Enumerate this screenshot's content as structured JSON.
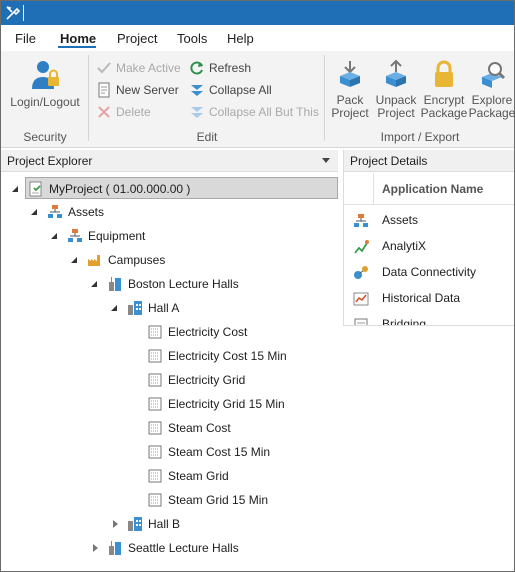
{
  "window": {
    "title": ""
  },
  "menu": {
    "items": [
      {
        "label": "File"
      },
      {
        "label": "Home"
      },
      {
        "label": "Project"
      },
      {
        "label": "Tools"
      },
      {
        "label": "Help"
      }
    ],
    "active": "Home"
  },
  "ribbon": {
    "security": {
      "group_label": "Security",
      "login_label": "Login/Logout"
    },
    "edit": {
      "group_label": "Edit",
      "make_active": "Make Active",
      "new_server": "New Server",
      "delete": "Delete",
      "refresh": "Refresh",
      "collapse_all": "Collapse All",
      "collapse_all_but_this": "Collapse All But This"
    },
    "import_export": {
      "group_label": "Import / Export",
      "pack_line1": "Pack",
      "pack_line2": "Project",
      "unpack_line1": "Unpack",
      "unpack_line2": "Project",
      "encrypt_line1": "Encrypt",
      "encrypt_line2": "Package",
      "explore_line1": "Explore",
      "explore_line2": "Package"
    }
  },
  "explorer": {
    "title": "Project Explorer",
    "nodes": [
      {
        "label": "MyProject ( 01.00.000.00 )",
        "icon": "project-icon",
        "selected": true
      },
      {
        "label": "Assets",
        "icon": "assets-icon"
      },
      {
        "label": "Equipment",
        "icon": "equipment-icon"
      },
      {
        "label": "Campuses",
        "icon": "campus-icon"
      },
      {
        "label": "Boston Lecture Halls",
        "icon": "building-icon"
      },
      {
        "label": "Hall A",
        "icon": "hall-icon"
      },
      {
        "label": "Electricity Cost",
        "icon": "tag-icon"
      },
      {
        "label": "Electricity Cost 15 Min",
        "icon": "tag-icon"
      },
      {
        "label": "Electricity Grid",
        "icon": "tag-icon"
      },
      {
        "label": "Electricity Grid 15 Min",
        "icon": "tag-icon"
      },
      {
        "label": "Steam Cost",
        "icon": "tag-icon"
      },
      {
        "label": "Steam Cost 15 Min",
        "icon": "tag-icon"
      },
      {
        "label": "Steam Grid",
        "icon": "tag-icon"
      },
      {
        "label": "Steam Grid 15 Min",
        "icon": "tag-icon"
      },
      {
        "label": "Hall B",
        "icon": "hall-icon"
      },
      {
        "label": "Seattle Lecture Halls",
        "icon": "building-icon"
      }
    ]
  },
  "details": {
    "title": "Project Details",
    "column_header": "Application Name",
    "apps": [
      {
        "label": "Assets",
        "icon": "assets-icon"
      },
      {
        "label": "AnalytiX",
        "icon": "analytix-icon"
      },
      {
        "label": "Data Connectivity",
        "icon": "data-connectivity-icon"
      },
      {
        "label": "Historical Data",
        "icon": "historical-data-icon"
      },
      {
        "label": "Bridging",
        "icon": "bridging-icon"
      }
    ]
  },
  "colors": {
    "titlebar": "#1f6fb6",
    "accent": "#1f6fb6",
    "ribbon_bg": "#f3f3f3",
    "lock_gold": "#e8b634",
    "arrow_blue": "#3a8fd0"
  }
}
